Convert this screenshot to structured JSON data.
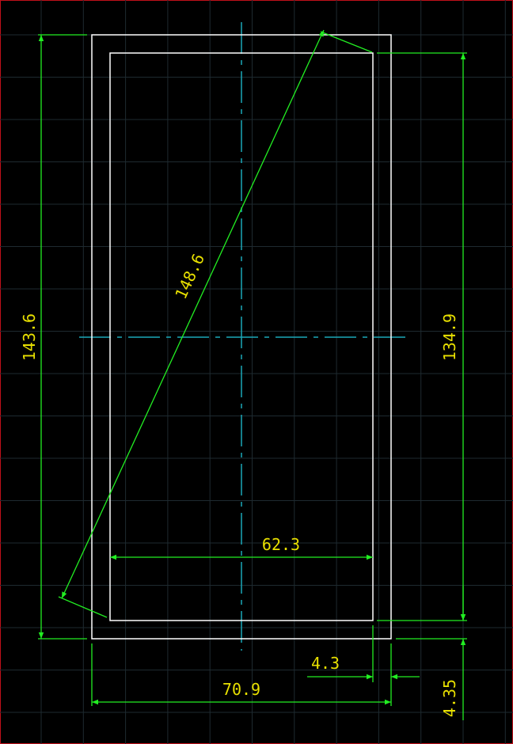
{
  "colors": {
    "background": "#000000",
    "grid": "#1e2a30",
    "outline": "#ffffff",
    "dimension_line": "#22ee22",
    "dimension_text": "#e8e000",
    "centerline": "#1aa8b8",
    "border": "#c0101a"
  },
  "dimensions": {
    "outer_height": "143.6",
    "diagonal": "148.6",
    "inner_height": "134.9",
    "inner_width": "62.3",
    "outer_width": "70.9",
    "side_margin": "4.3",
    "bottom_margin": "4.35"
  }
}
